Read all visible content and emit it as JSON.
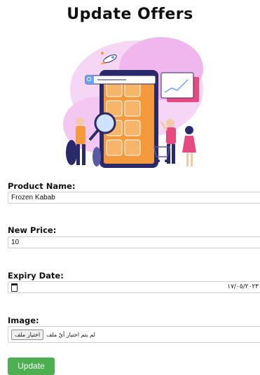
{
  "page": {
    "title": "Update Offers"
  },
  "form": {
    "product_name": {
      "label": "Product Name:",
      "value": "Frozen Kabab"
    },
    "new_price": {
      "label": "New Price:",
      "value": "10"
    },
    "expiry_date": {
      "label": "Expiry Date:",
      "value": "١٧/٠٥/٢٠٢٣",
      "icon": "calendar-icon"
    },
    "image": {
      "label": "Image:",
      "button_label": "اختيار ملف",
      "status": "لم يتم اختيار أيّ ملف"
    },
    "submit_label": "Update"
  },
  "colors": {
    "accent_green": "#4caf50",
    "illustration_pink": "#f3c6f0",
    "phone_dark": "#2a2a6b",
    "screen_orange": "#f59a3c"
  }
}
